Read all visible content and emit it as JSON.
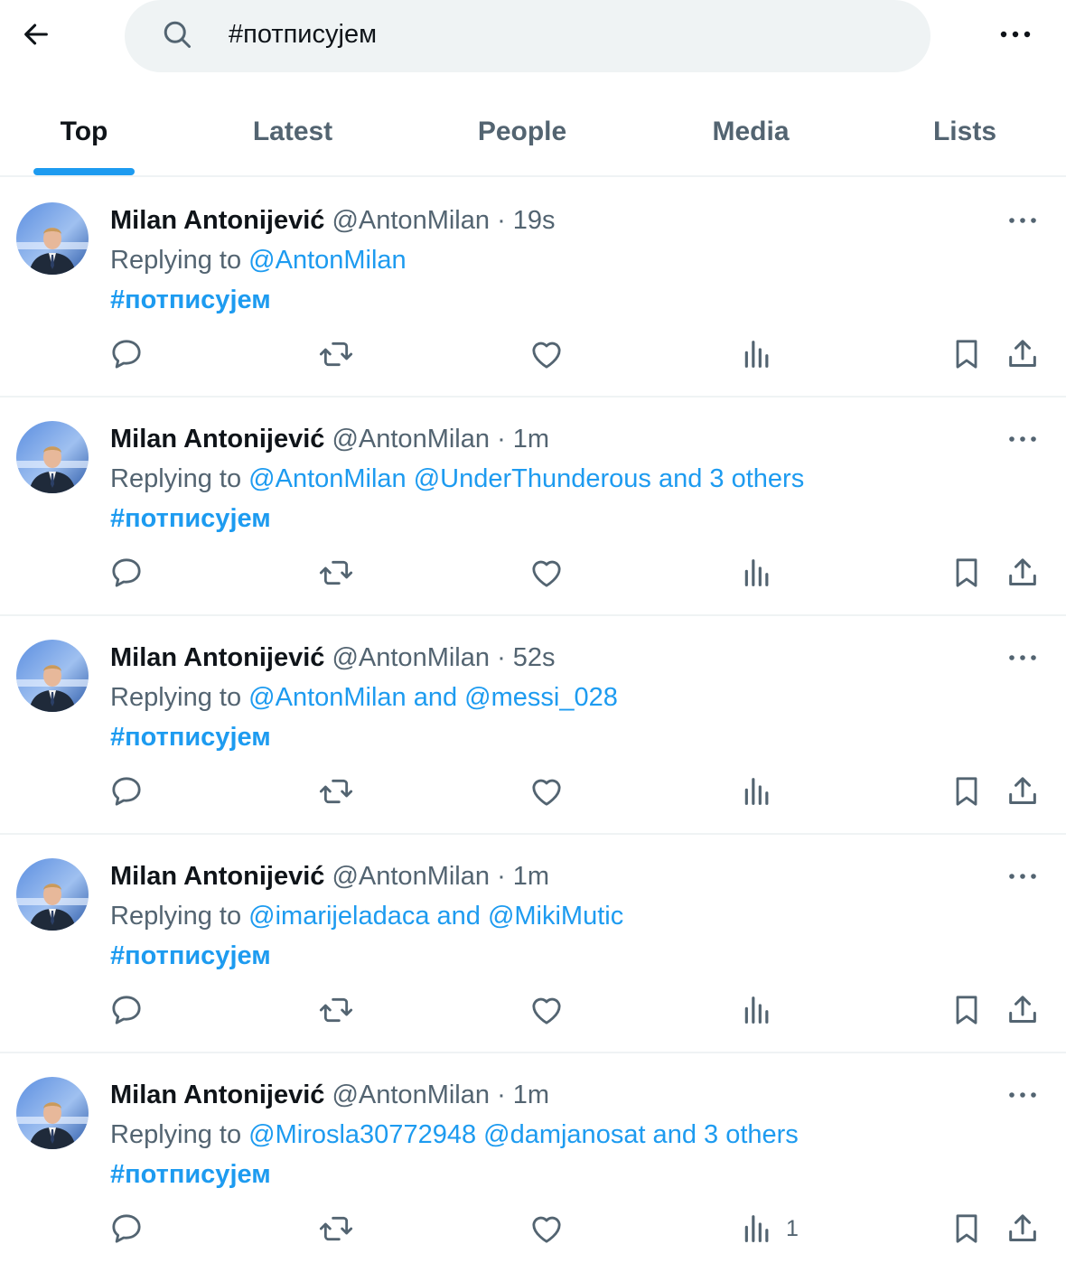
{
  "search": {
    "query": "#потписујем"
  },
  "tabs": [
    {
      "label": "Top",
      "active": true
    },
    {
      "label": "Latest",
      "active": false
    },
    {
      "label": "People",
      "active": false
    },
    {
      "label": "Media",
      "active": false
    },
    {
      "label": "Lists",
      "active": false
    }
  ],
  "posts": [
    {
      "author": "Milan Antonijević",
      "handle": "@AntonMilan",
      "time": "19s",
      "reply_prefix": "Replying to",
      "reply_to": "@AntonMilan",
      "hashtag": "#потписујем",
      "views": ""
    },
    {
      "author": "Milan Antonijević",
      "handle": "@AntonMilan",
      "time": "1m",
      "reply_prefix": "Replying to",
      "reply_to": "@AntonMilan @UnderThunderous and 3 others",
      "hashtag": "#потписујем",
      "views": ""
    },
    {
      "author": "Milan Antonijević",
      "handle": "@AntonMilan",
      "time": "52s",
      "reply_prefix": "Replying to",
      "reply_to": "@AntonMilan and @messi_028",
      "hashtag": "#потписујем",
      "views": ""
    },
    {
      "author": "Milan Antonijević",
      "handle": "@AntonMilan",
      "time": "1m",
      "reply_prefix": "Replying to",
      "reply_to": "@imarijeladaca and @MikiMutic",
      "hashtag": "#потписујем",
      "views": ""
    },
    {
      "author": "Milan Antonijević",
      "handle": "@AntonMilan",
      "time": "1m",
      "reply_prefix": "Replying to",
      "reply_to": "@Mirosla30772948 @damjanosat and 3 others",
      "hashtag": "#потписујем",
      "views": "1"
    }
  ],
  "separator": "·",
  "colors": {
    "accent": "#1d9bf0",
    "secondary_text": "#536471",
    "search_bg": "#eff3f4"
  },
  "icons": [
    "back-arrow-icon",
    "search-icon",
    "more-icon",
    "reply-icon",
    "retweet-icon",
    "like-icon",
    "views-icon",
    "bookmark-icon",
    "share-icon"
  ]
}
